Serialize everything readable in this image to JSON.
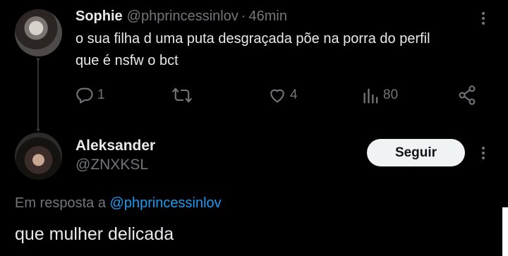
{
  "tweet": {
    "author_name": "Sophie",
    "author_handle": "@phprincessinlov",
    "separator": "·",
    "time": "46min",
    "text_line1": "o sua filha d uma puta desgraçada põe na porra do perfil",
    "text_line2": "que é nsfw o bct",
    "actions": {
      "replies": "1",
      "retweets": "",
      "likes": "4",
      "views": "80"
    }
  },
  "reply": {
    "author_name": "Aleksander",
    "author_handle": "@ZNXKSL",
    "follow_label": "Seguir",
    "in_reply_prefix": "Em resposta a",
    "in_reply_mention": "@phprincessinlov",
    "text": "que mulher delicada"
  },
  "colors": {
    "background": "#000000",
    "text": "#e7e9ea",
    "muted": "#71767b",
    "link": "#1d9bf0",
    "button_bg": "#eff3f4"
  },
  "icons": [
    "reply-icon",
    "retweet-icon",
    "like-icon",
    "views-icon",
    "share-icon",
    "more-icon"
  ]
}
